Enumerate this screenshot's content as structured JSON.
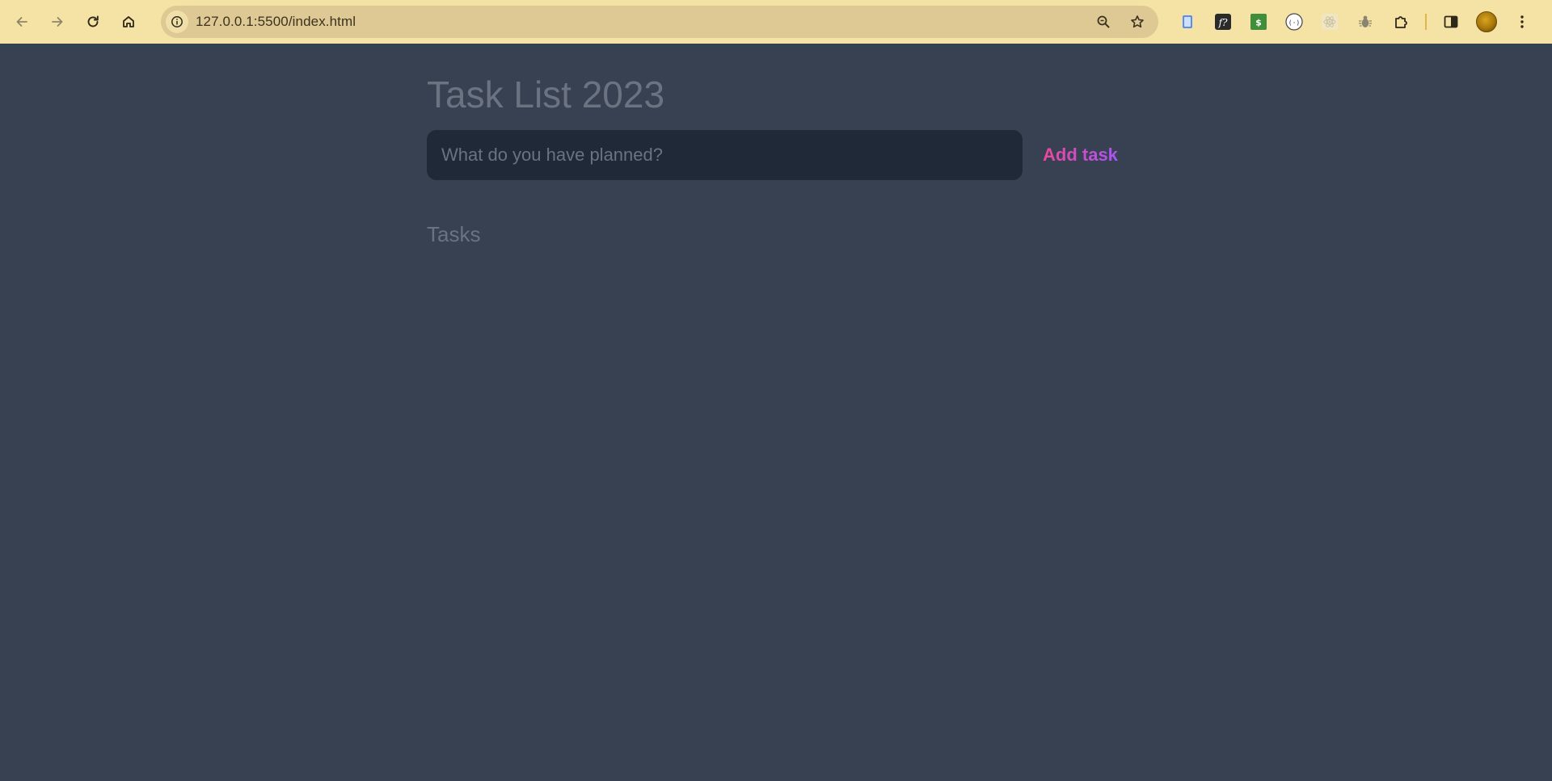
{
  "browser": {
    "url": "127.0.0.1:5500/index.html",
    "icons": {
      "back": "arrow-left-icon",
      "forward": "arrow-right-icon",
      "reload": "reload-icon",
      "home": "home-icon",
      "site_info": "info-icon",
      "zoom": "zoom-icon",
      "bookmark": "star-icon",
      "extensions": [
        "notes-extension-icon",
        "formula-extension-icon",
        "dollar-extension-icon",
        "code-extension-icon",
        "react-extension-icon",
        "bug-extension-icon",
        "puzzle-icon",
        "side-panel-icon",
        "avatar",
        "kebab-menu-icon"
      ]
    },
    "colors": {
      "toolbar": "#f5e3a6",
      "omnibox": "#dec894"
    }
  },
  "app": {
    "title": "Task List 2023",
    "input_placeholder": "What do you have planned?",
    "add_button_label": "Add task",
    "tasks_heading": "Tasks",
    "tasks": []
  },
  "colors": {
    "background": "#374151",
    "input_bg": "#1f2937",
    "muted_text": "#6b7280",
    "accent_gradient": [
      "#ec4899",
      "#a855f7"
    ]
  }
}
